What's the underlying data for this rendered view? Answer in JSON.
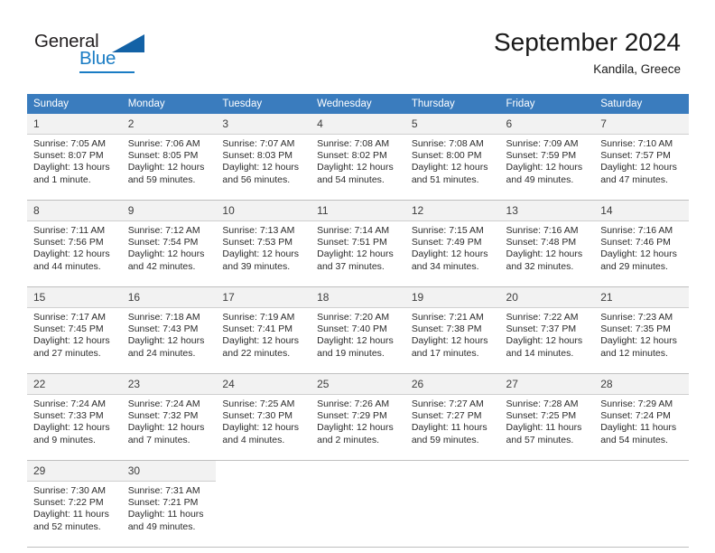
{
  "logo": {
    "word1": "General",
    "word2": "Blue",
    "triangle_color": "#1362a6",
    "blue_color": "#1a7cc4"
  },
  "header": {
    "month_title": "September 2024",
    "location": "Kandila, Greece"
  },
  "theme": {
    "header_row_bg": "#3a7cbe",
    "daynum_bg": "#f2f2f2",
    "grid_line": "#bfbfbf"
  },
  "weekdays": [
    "Sunday",
    "Monday",
    "Tuesday",
    "Wednesday",
    "Thursday",
    "Friday",
    "Saturday"
  ],
  "weeks": [
    [
      {
        "day": "1",
        "sunrise": "Sunrise: 7:05 AM",
        "sunset": "Sunset: 8:07 PM",
        "daylight1": "Daylight: 13 hours",
        "daylight2": "and 1 minute."
      },
      {
        "day": "2",
        "sunrise": "Sunrise: 7:06 AM",
        "sunset": "Sunset: 8:05 PM",
        "daylight1": "Daylight: 12 hours",
        "daylight2": "and 59 minutes."
      },
      {
        "day": "3",
        "sunrise": "Sunrise: 7:07 AM",
        "sunset": "Sunset: 8:03 PM",
        "daylight1": "Daylight: 12 hours",
        "daylight2": "and 56 minutes."
      },
      {
        "day": "4",
        "sunrise": "Sunrise: 7:08 AM",
        "sunset": "Sunset: 8:02 PM",
        "daylight1": "Daylight: 12 hours",
        "daylight2": "and 54 minutes."
      },
      {
        "day": "5",
        "sunrise": "Sunrise: 7:08 AM",
        "sunset": "Sunset: 8:00 PM",
        "daylight1": "Daylight: 12 hours",
        "daylight2": "and 51 minutes."
      },
      {
        "day": "6",
        "sunrise": "Sunrise: 7:09 AM",
        "sunset": "Sunset: 7:59 PM",
        "daylight1": "Daylight: 12 hours",
        "daylight2": "and 49 minutes."
      },
      {
        "day": "7",
        "sunrise": "Sunrise: 7:10 AM",
        "sunset": "Sunset: 7:57 PM",
        "daylight1": "Daylight: 12 hours",
        "daylight2": "and 47 minutes."
      }
    ],
    [
      {
        "day": "8",
        "sunrise": "Sunrise: 7:11 AM",
        "sunset": "Sunset: 7:56 PM",
        "daylight1": "Daylight: 12 hours",
        "daylight2": "and 44 minutes."
      },
      {
        "day": "9",
        "sunrise": "Sunrise: 7:12 AM",
        "sunset": "Sunset: 7:54 PM",
        "daylight1": "Daylight: 12 hours",
        "daylight2": "and 42 minutes."
      },
      {
        "day": "10",
        "sunrise": "Sunrise: 7:13 AM",
        "sunset": "Sunset: 7:53 PM",
        "daylight1": "Daylight: 12 hours",
        "daylight2": "and 39 minutes."
      },
      {
        "day": "11",
        "sunrise": "Sunrise: 7:14 AM",
        "sunset": "Sunset: 7:51 PM",
        "daylight1": "Daylight: 12 hours",
        "daylight2": "and 37 minutes."
      },
      {
        "day": "12",
        "sunrise": "Sunrise: 7:15 AM",
        "sunset": "Sunset: 7:49 PM",
        "daylight1": "Daylight: 12 hours",
        "daylight2": "and 34 minutes."
      },
      {
        "day": "13",
        "sunrise": "Sunrise: 7:16 AM",
        "sunset": "Sunset: 7:48 PM",
        "daylight1": "Daylight: 12 hours",
        "daylight2": "and 32 minutes."
      },
      {
        "day": "14",
        "sunrise": "Sunrise: 7:16 AM",
        "sunset": "Sunset: 7:46 PM",
        "daylight1": "Daylight: 12 hours",
        "daylight2": "and 29 minutes."
      }
    ],
    [
      {
        "day": "15",
        "sunrise": "Sunrise: 7:17 AM",
        "sunset": "Sunset: 7:45 PM",
        "daylight1": "Daylight: 12 hours",
        "daylight2": "and 27 minutes."
      },
      {
        "day": "16",
        "sunrise": "Sunrise: 7:18 AM",
        "sunset": "Sunset: 7:43 PM",
        "daylight1": "Daylight: 12 hours",
        "daylight2": "and 24 minutes."
      },
      {
        "day": "17",
        "sunrise": "Sunrise: 7:19 AM",
        "sunset": "Sunset: 7:41 PM",
        "daylight1": "Daylight: 12 hours",
        "daylight2": "and 22 minutes."
      },
      {
        "day": "18",
        "sunrise": "Sunrise: 7:20 AM",
        "sunset": "Sunset: 7:40 PM",
        "daylight1": "Daylight: 12 hours",
        "daylight2": "and 19 minutes."
      },
      {
        "day": "19",
        "sunrise": "Sunrise: 7:21 AM",
        "sunset": "Sunset: 7:38 PM",
        "daylight1": "Daylight: 12 hours",
        "daylight2": "and 17 minutes."
      },
      {
        "day": "20",
        "sunrise": "Sunrise: 7:22 AM",
        "sunset": "Sunset: 7:37 PM",
        "daylight1": "Daylight: 12 hours",
        "daylight2": "and 14 minutes."
      },
      {
        "day": "21",
        "sunrise": "Sunrise: 7:23 AM",
        "sunset": "Sunset: 7:35 PM",
        "daylight1": "Daylight: 12 hours",
        "daylight2": "and 12 minutes."
      }
    ],
    [
      {
        "day": "22",
        "sunrise": "Sunrise: 7:24 AM",
        "sunset": "Sunset: 7:33 PM",
        "daylight1": "Daylight: 12 hours",
        "daylight2": "and 9 minutes."
      },
      {
        "day": "23",
        "sunrise": "Sunrise: 7:24 AM",
        "sunset": "Sunset: 7:32 PM",
        "daylight1": "Daylight: 12 hours",
        "daylight2": "and 7 minutes."
      },
      {
        "day": "24",
        "sunrise": "Sunrise: 7:25 AM",
        "sunset": "Sunset: 7:30 PM",
        "daylight1": "Daylight: 12 hours",
        "daylight2": "and 4 minutes."
      },
      {
        "day": "25",
        "sunrise": "Sunrise: 7:26 AM",
        "sunset": "Sunset: 7:29 PM",
        "daylight1": "Daylight: 12 hours",
        "daylight2": "and 2 minutes."
      },
      {
        "day": "26",
        "sunrise": "Sunrise: 7:27 AM",
        "sunset": "Sunset: 7:27 PM",
        "daylight1": "Daylight: 11 hours",
        "daylight2": "and 59 minutes."
      },
      {
        "day": "27",
        "sunrise": "Sunrise: 7:28 AM",
        "sunset": "Sunset: 7:25 PM",
        "daylight1": "Daylight: 11 hours",
        "daylight2": "and 57 minutes."
      },
      {
        "day": "28",
        "sunrise": "Sunrise: 7:29 AM",
        "sunset": "Sunset: 7:24 PM",
        "daylight1": "Daylight: 11 hours",
        "daylight2": "and 54 minutes."
      }
    ],
    [
      {
        "day": "29",
        "sunrise": "Sunrise: 7:30 AM",
        "sunset": "Sunset: 7:22 PM",
        "daylight1": "Daylight: 11 hours",
        "daylight2": "and 52 minutes."
      },
      {
        "day": "30",
        "sunrise": "Sunrise: 7:31 AM",
        "sunset": "Sunset: 7:21 PM",
        "daylight1": "Daylight: 11 hours",
        "daylight2": "and 49 minutes."
      },
      {
        "day": "",
        "sunrise": "",
        "sunset": "",
        "daylight1": "",
        "daylight2": ""
      },
      {
        "day": "",
        "sunrise": "",
        "sunset": "",
        "daylight1": "",
        "daylight2": ""
      },
      {
        "day": "",
        "sunrise": "",
        "sunset": "",
        "daylight1": "",
        "daylight2": ""
      },
      {
        "day": "",
        "sunrise": "",
        "sunset": "",
        "daylight1": "",
        "daylight2": ""
      },
      {
        "day": "",
        "sunrise": "",
        "sunset": "",
        "daylight1": "",
        "daylight2": ""
      }
    ]
  ]
}
